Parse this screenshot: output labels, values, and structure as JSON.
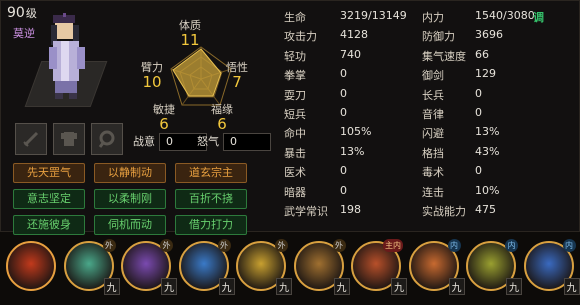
{
  "character": {
    "level": "90",
    "level_unit": "级",
    "name": "莫逆"
  },
  "core_stats": {
    "constitution": {
      "label": "体质",
      "value": "11"
    },
    "arm_strength": {
      "label": "臂力",
      "value": "10"
    },
    "comprehension": {
      "label": "悟性",
      "value": "7"
    },
    "agility": {
      "label": "敏捷",
      "value": "6"
    },
    "fortune": {
      "label": "福缘",
      "value": "6"
    }
  },
  "battle": {
    "fighting_spirit": {
      "label": "战意",
      "value": "0"
    },
    "rage": {
      "label": "怒气",
      "value": "0"
    }
  },
  "traits": [
    {
      "label": "先天罡气",
      "color": "orange"
    },
    {
      "label": "以静制动",
      "color": "orange"
    },
    {
      "label": "道玄宗主",
      "color": "orange"
    },
    {
      "label": "意志坚定",
      "color": "green"
    },
    {
      "label": "以柔制刚",
      "color": "green"
    },
    {
      "label": "百折不挠",
      "color": "green"
    },
    {
      "label": "还施彼身",
      "color": "green"
    },
    {
      "label": "伺机而动",
      "color": "green"
    },
    {
      "label": "借力打力",
      "color": "green"
    }
  ],
  "attributes": [
    {
      "k1": "生命",
      "v1": "3219/13149",
      "k2": "内力",
      "v2": "1540/3080"
    },
    {
      "k1": "攻击力",
      "v1": "4128",
      "k2": "防御力",
      "v2": "3696"
    },
    {
      "k1": "轻功",
      "v1": "740",
      "k2": "集气速度",
      "v2": "66"
    },
    {
      "k1": "拳掌",
      "v1": "0",
      "k2": "御剑",
      "v2": "129"
    },
    {
      "k1": "耍刀",
      "v1": "0",
      "k2": "长兵",
      "v2": "0"
    },
    {
      "k1": "短兵",
      "v1": "0",
      "k2": "音律",
      "v2": "0"
    },
    {
      "k1": "命中",
      "v1": "105%",
      "k2": "闪避",
      "v2": "13%"
    },
    {
      "k1": "暴击",
      "v1": "13%",
      "k2": "格挡",
      "v2": "43%"
    },
    {
      "k1": "医术",
      "v1": "0",
      "k2": "毒术",
      "v2": "0"
    },
    {
      "k1": "暗器",
      "v1": "0",
      "k2": "连击",
      "v2": "10%"
    },
    {
      "k1": "武学常识",
      "v1": "198",
      "k2": "实战能力",
      "v2": "475"
    }
  ],
  "adjust_label": "调",
  "skills": [
    {
      "icon": "red-lantern-skill-icon",
      "color": "#c23a1c",
      "ring": "#e8a040",
      "badge": "",
      "badge_type": "",
      "level": ""
    },
    {
      "icon": "green-wind-skill-icon",
      "color": "#4aa88a",
      "ring": "#d8a040",
      "badge": "外",
      "badge_type": "w",
      "level": "九"
    },
    {
      "icon": "yinyang-skill-icon",
      "color": "#7a4ab0",
      "ring": "#d8a040",
      "badge": "外",
      "badge_type": "w",
      "level": "九"
    },
    {
      "icon": "blue-claw-skill-icon",
      "color": "#3a7ac8",
      "ring": "#d8a040",
      "badge": "外",
      "badge_type": "w",
      "level": "九"
    },
    {
      "icon": "golden-rain-skill-icon",
      "color": "#c8a030",
      "ring": "#d8a040",
      "badge": "外",
      "badge_type": "w",
      "level": "九"
    },
    {
      "icon": "sword-skill-icon",
      "color": "#a07030",
      "ring": "#d8a040",
      "badge": "外",
      "badge_type": "w",
      "level": "九"
    },
    {
      "icon": "fire-palm-skill-icon",
      "color": "#b8502a",
      "ring": "#d8a040",
      "badge": "主内",
      "badge_type": "z",
      "level": "九"
    },
    {
      "icon": "flame-circle-skill-icon",
      "color": "#c86a30",
      "ring": "#d8a040",
      "badge": "内",
      "badge_type": "n",
      "level": "九"
    },
    {
      "icon": "golden-orb-skill-icon",
      "color": "#9aa030",
      "ring": "#d8a040",
      "badge": "内",
      "badge_type": "n",
      "level": "九"
    },
    {
      "icon": "blue-swirl-skill-icon",
      "color": "#3a6ac0",
      "ring": "#d8a040",
      "badge": "内",
      "badge_type": "n",
      "level": "九"
    }
  ]
}
